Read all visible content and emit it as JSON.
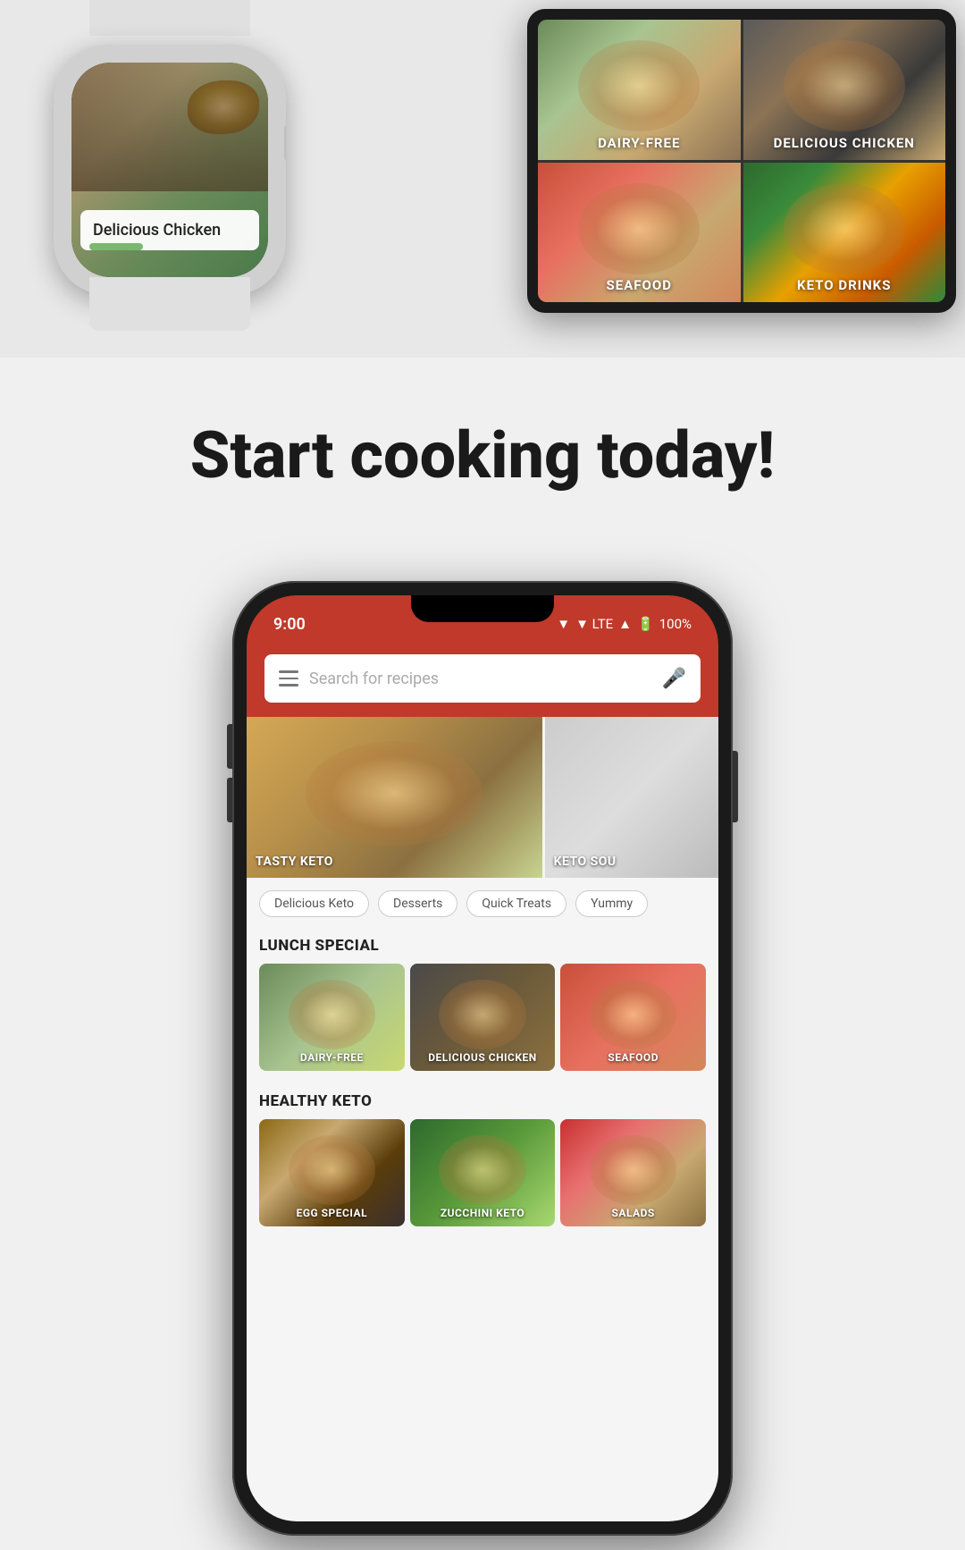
{
  "watch": {
    "label": "Delicious Chicken"
  },
  "tablet": {
    "cells": [
      {
        "id": "dairy-free",
        "label": "DAIRY-FREE"
      },
      {
        "id": "delicious-chicken",
        "label": "DELICIOUS CHICKEN"
      },
      {
        "id": "seafood",
        "label": "SEAFOOD"
      },
      {
        "id": "keto-drinks",
        "label": "KETO DRINKS"
      }
    ]
  },
  "tagline": "Start cooking today!",
  "phone": {
    "status": {
      "time": "9:00",
      "network": "▼ LTE",
      "battery": "100%"
    },
    "search": {
      "placeholder": "Search for recipes"
    },
    "hero_cards": [
      {
        "label": "TASTY KETO"
      },
      {
        "label": "KETO SOU"
      }
    ],
    "tags": [
      "Delicious Keto",
      "Desserts",
      "Quick Treats",
      "Yummy"
    ],
    "sections": [
      {
        "header": "LUNCH SPECIAL",
        "cards": [
          {
            "label": "DAIRY-FREE"
          },
          {
            "label": "DELICIOUS CHICKEN"
          },
          {
            "label": "SEAFOOD"
          }
        ]
      },
      {
        "header": "HEALTHY KETO",
        "cards": [
          {
            "label": "EGG SPECIAL"
          },
          {
            "label": "ZUCCHINI KETO"
          },
          {
            "label": "SALADS"
          }
        ]
      }
    ]
  }
}
